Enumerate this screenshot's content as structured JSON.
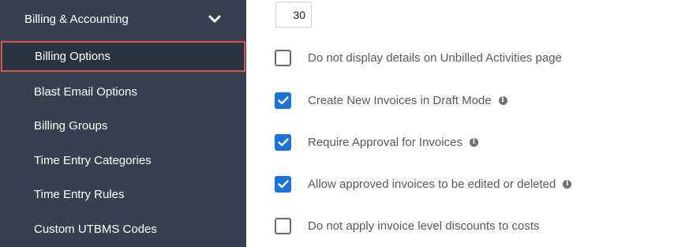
{
  "sidebar": {
    "section_title": "Billing & Accounting",
    "items": [
      {
        "label": "Billing Options"
      },
      {
        "label": "Blast Email Options"
      },
      {
        "label": "Billing Groups"
      },
      {
        "label": "Time Entry Categories"
      },
      {
        "label": "Time Entry Rules"
      },
      {
        "label": "Custom UTBMS Codes"
      }
    ]
  },
  "main": {
    "days_value": "30",
    "options": [
      {
        "label": "Do not display details on Unbilled Activities page",
        "checked": false,
        "info": false
      },
      {
        "label": "Create New Invoices in Draft Mode",
        "checked": true,
        "info": true
      },
      {
        "label": "Require Approval for Invoices",
        "checked": true,
        "info": true
      },
      {
        "label": "Allow approved invoices to be edited or deleted",
        "checked": true,
        "info": true
      },
      {
        "label": "Do not apply invoice level discounts to costs",
        "checked": false,
        "info": false
      }
    ]
  },
  "colors": {
    "sidebar_bg": "#37404e",
    "active_border": "#d9534f",
    "checkbox_checked": "#1a73d6"
  },
  "icons": {
    "chevron": "chevron-down-icon",
    "info": "info-icon",
    "check": "check-icon"
  }
}
